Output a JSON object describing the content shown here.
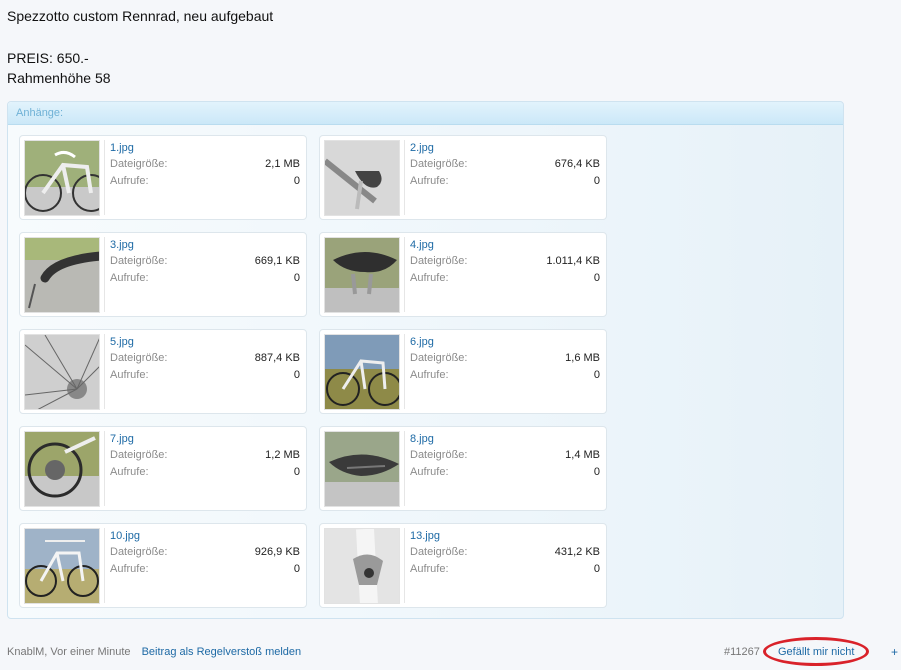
{
  "post": {
    "title": "Spezzotto custom Rennrad, neu aufgebaut",
    "price": "PREIS: 650.-",
    "frame": "Rahmenhöhe 58"
  },
  "attachments": {
    "header": "Anhänge:",
    "size_label": "Dateigröße:",
    "views_label": "Aufrufe:",
    "items": [
      {
        "name": "1.jpg",
        "size": "2,1 MB",
        "views": "0",
        "thumb": "bike-frame-photo"
      },
      {
        "name": "2.jpg",
        "size": "676,4 KB",
        "views": "0",
        "thumb": "brake-lever-photo"
      },
      {
        "name": "3.jpg",
        "size": "669,1 KB",
        "views": "0",
        "thumb": "handlebar-photo"
      },
      {
        "name": "4.jpg",
        "size": "1.011,4 KB",
        "views": "0",
        "thumb": "saddle-photo"
      },
      {
        "name": "5.jpg",
        "size": "887,4 KB",
        "views": "0",
        "thumb": "wheel-hub-photo"
      },
      {
        "name": "6.jpg",
        "size": "1,6 MB",
        "views": "0",
        "thumb": "bike-side-photo"
      },
      {
        "name": "7.jpg",
        "size": "1,2 MB",
        "views": "0",
        "thumb": "rear-cassette-photo"
      },
      {
        "name": "8.jpg",
        "size": "1,4 MB",
        "views": "0",
        "thumb": "saddle-top-photo"
      },
      {
        "name": "10.jpg",
        "size": "926,9 KB",
        "views": "0",
        "thumb": "full-bike-photo"
      },
      {
        "name": "13.jpg",
        "size": "431,2 KB",
        "views": "0",
        "thumb": "brake-caliper-photo"
      }
    ]
  },
  "footer": {
    "author": "KnablM, Vor einer Minute",
    "report": "Beitrag als Regelverstoß melden",
    "post_number": "#11267",
    "like": "Gefällt mir nicht",
    "plus": "+"
  },
  "colors": {
    "link": "#1e6aa5",
    "highlight_circle": "#d9222a",
    "header_text": "#6fb1d6"
  }
}
